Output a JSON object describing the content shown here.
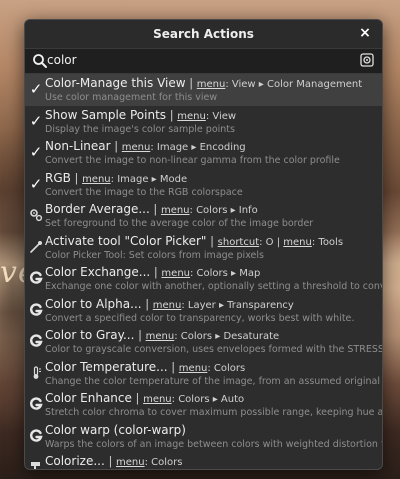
{
  "dialog": {
    "title": "Search Actions",
    "close_label": "×"
  },
  "search": {
    "value": "color",
    "placeholder": ""
  },
  "results": [
    {
      "icon": "check-icon",
      "name": "Color-Manage this View",
      "sep": " | ",
      "kw": "menu",
      "path": ": View ▸ Color Management",
      "desc": "Use color management for this view",
      "selected": true
    },
    {
      "icon": "check-icon",
      "name": "Show Sample Points",
      "sep": " | ",
      "kw": "menu",
      "path": ": View",
      "desc": "Display the image's color sample points"
    },
    {
      "icon": "check-icon",
      "name": "Non-Linear",
      "sep": " | ",
      "kw": "menu",
      "path": ": Image ▸ Encoding",
      "desc": "Convert the image to non-linear gamma from the color profile"
    },
    {
      "icon": "check-icon",
      "name": "RGB",
      "sep": " | ",
      "kw": "menu",
      "path": ": Image ▸ Mode",
      "desc": "Convert the image to the RGB colorspace"
    },
    {
      "icon": "gears-icon",
      "name": "Border Average...",
      "sep": " | ",
      "kw": "menu",
      "path": ": Colors ▸ Info",
      "desc": "Set foreground to the average color of the image border"
    },
    {
      "icon": "color-picker-icon",
      "name": "Activate tool \"Color Picker\"",
      "sep": " | ",
      "kw": "shortcut",
      "path": ": O | ",
      "kw2": "menu",
      "path2": ": Tools",
      "desc": "Color Picker Tool: Set colors from image pixels"
    },
    {
      "icon": "gegl-icon",
      "name": "Color Exchange...",
      "sep": " | ",
      "kw": "menu",
      "path": ": Colors ▸ Map",
      "desc": "Exchange one color with another, optionally setting a threshold to convert from one shad"
    },
    {
      "icon": "gegl-icon",
      "name": "Color to Alpha...",
      "sep": " | ",
      "kw": "menu",
      "path": ": Layer ▸ Transparency",
      "desc": "Convert a specified color to transparency, works best with white."
    },
    {
      "icon": "gegl-icon",
      "name": "Color to Gray...",
      "sep": " | ",
      "kw": "menu",
      "path": ": Colors ▸ Desaturate",
      "desc": "Color to grayscale conversion, uses envelopes formed with the STRESS approach to perfo"
    },
    {
      "icon": "thermometer-icon",
      "name": "Color Temperature...",
      "sep": " | ",
      "kw": "menu",
      "path": ": Colors",
      "desc": "Change the color temperature of the image, from an assumed original color temperature to"
    },
    {
      "icon": "gegl-icon",
      "name": "Color Enhance",
      "sep": " | ",
      "kw": "menu",
      "path": ": Colors ▸ Auto",
      "desc": "Stretch color chroma to cover maximum possible range, keeping hue and lightness untouc"
    },
    {
      "icon": "gegl-icon",
      "name": "Color warp (color-warp)",
      "sep": "",
      "kw": "",
      "path": "",
      "desc": "Warps the colors of an image between colors with weighted distortion factors, color pairs"
    },
    {
      "icon": "colorize-icon",
      "name": "Colorize...",
      "sep": " | ",
      "kw": "menu",
      "path": ": Colors",
      "desc": ""
    }
  ],
  "background": {
    "edge_text": "ve"
  }
}
